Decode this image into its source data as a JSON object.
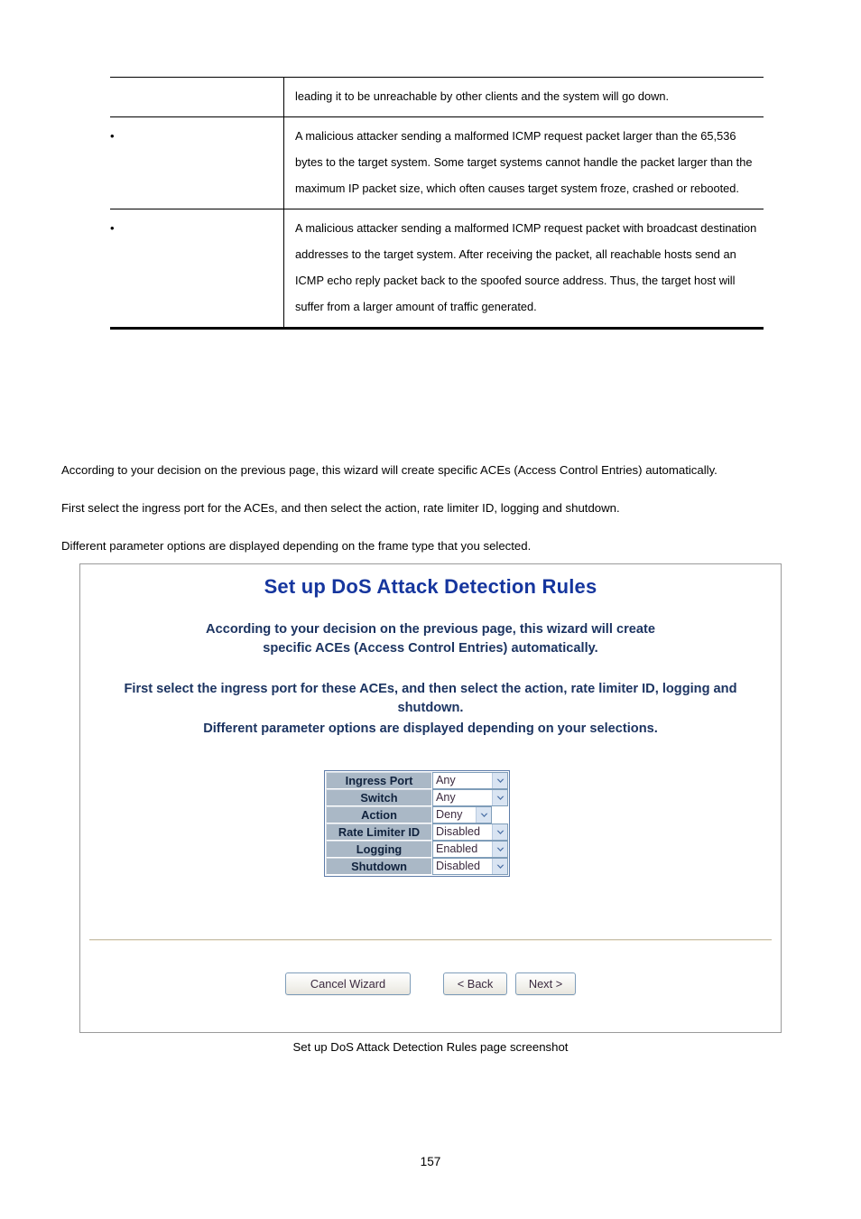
{
  "document": {
    "page_number": "157",
    "figure_caption": "Set up DoS Attack Detection Rules page screenshot"
  },
  "desc_table": {
    "rows": [
      {
        "bullet": false,
        "text": "leading it to be unreachable by other clients and the system will go down."
      },
      {
        "bullet": true,
        "text": "A malicious attacker sending a malformed ICMP request packet larger than the 65,536 bytes to the target system. Some target systems cannot handle the packet larger than the maximum IP packet size, which often causes target system froze, crashed or rebooted."
      },
      {
        "bullet": true,
        "text": "A malicious attacker sending a malformed ICMP request packet with broadcast destination addresses to the target system. After receiving the packet, all reachable hosts send an ICMP echo reply packet back to the spoofed source address. Thus, the target host will suffer from a larger amount of traffic generated."
      }
    ]
  },
  "body": {
    "paragraphs": [
      "According to your decision on the previous page, this wizard will create specific ACEs (Access Control Entries) automatically.",
      "First select the ingress port for the ACEs, and then select the action, rate limiter ID, logging and shutdown.",
      "Different parameter options are displayed depending on the frame type that you selected."
    ]
  },
  "wizard": {
    "title": "Set up DoS Attack Detection Rules",
    "desc_line1": "According to your decision on the previous page, this wizard will create",
    "desc_line2": "specific ACEs (Access Control Entries) automatically.",
    "desc_line3": "First select the ingress port for these ACEs, and then select the action, rate limiter ID, logging and",
    "desc_line4": "shutdown.",
    "desc_line5": "Different parameter options are displayed depending on your selections.",
    "title_color": "#16369e",
    "desc_color": "#1c3461",
    "form": {
      "rows": [
        {
          "label": "Ingress Port",
          "value": "Any",
          "width_class": "w-any"
        },
        {
          "label": "Switch",
          "value": "Any",
          "width_class": "w-any2"
        },
        {
          "label": "Action",
          "value": "Deny",
          "width_class": "w-deny"
        },
        {
          "label": "Rate Limiter ID",
          "value": "Disabled",
          "width_class": "w-dis"
        },
        {
          "label": "Logging",
          "value": "Enabled",
          "width_class": "w-dis"
        },
        {
          "label": "Shutdown",
          "value": "Disabled",
          "width_class": "w-dis"
        }
      ],
      "label_bg": "#aab8c6",
      "select_border": "#7f9db9"
    },
    "buttons": {
      "cancel": "Cancel Wizard",
      "back": "< Back",
      "next": "Next >"
    }
  }
}
